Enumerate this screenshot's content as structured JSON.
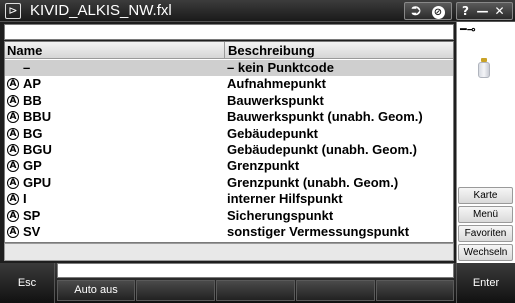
{
  "title": "KIVID_ALKIS_NW.fxl",
  "icons": {
    "app": "triangle-logo-icon",
    "login": "enter-arrow-icon",
    "stop": "no-entry-icon",
    "help": "help-icon",
    "minimize": "minimize-icon",
    "close": "close-icon",
    "power": "power-plug-icon",
    "battery": "battery-icon",
    "row": "circle-a-icon"
  },
  "titlebar_buttons": {
    "login": "⮊",
    "stop": "⊘",
    "help": "?",
    "minimize": "—",
    "close": "✕"
  },
  "search": {
    "value": "",
    "placeholder": ""
  },
  "table": {
    "columns": [
      "Name",
      "Beschreibung"
    ],
    "rows": [
      {
        "name": "–",
        "desc": "– kein Punktcode",
        "icon": false,
        "selected": true
      },
      {
        "name": "AP",
        "desc": "Aufnahmepunkt",
        "icon": true
      },
      {
        "name": "BB",
        "desc": "Bauwerkspunkt",
        "icon": true
      },
      {
        "name": "BBU",
        "desc": "Bauwerkspunkt (unabh. Geom.)",
        "icon": true
      },
      {
        "name": "BG",
        "desc": "Gebäudepunkt",
        "icon": true
      },
      {
        "name": "BGU",
        "desc": "Gebäudepunkt (unabh. Geom.)",
        "icon": true
      },
      {
        "name": "GP",
        "desc": "Grenzpunkt",
        "icon": true
      },
      {
        "name": "GPU",
        "desc": "Grenzpunkt (unabh. Geom.)",
        "icon": true
      },
      {
        "name": "I",
        "desc": "interner Hilfspunkt",
        "icon": true
      },
      {
        "name": "SP",
        "desc": "Sicherungspunkt",
        "icon": true
      },
      {
        "name": "SV",
        "desc": "sonstiger Vermessungspunkt",
        "icon": true
      }
    ]
  },
  "sidebar": {
    "karte": "Karte",
    "menu": "Menü",
    "favoriten": "Favoriten",
    "wechseln": "Wechseln"
  },
  "bottom": {
    "esc": "Esc",
    "enter": "Enter",
    "auto_aus": "Auto aus",
    "status_text": ""
  },
  "colors": {
    "titlebar": "#1a1a1a",
    "selected_row": "#cfcfcf",
    "list_bg": "#ffffff"
  }
}
